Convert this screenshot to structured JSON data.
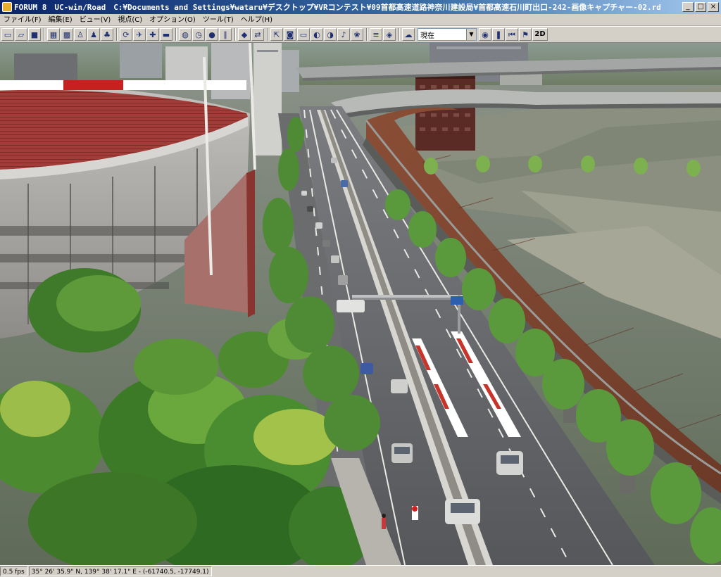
{
  "window": {
    "title": "FORUM 8　UC-win/Road　C:¥Documents and Settings¥wataru¥デスクトップ¥VRコンテスト¥09首都高速道路神奈川建設局¥首都高速石川町出口-242-画像キャプチャー-02.rd",
    "controls": {
      "minimize": "_",
      "maximize": "□",
      "close": "×"
    }
  },
  "menu": {
    "items": [
      "ファイル(F)",
      "編集(E)",
      "ビュー(V)",
      "視点(C)",
      "オプション(O)",
      "ツール(T)",
      "ヘルプ(H)"
    ]
  },
  "toolbar": {
    "icons": [
      "new-file-icon",
      "open-folder-icon",
      "save-icon",
      "sep",
      "scene-view-icon",
      "map-view-icon",
      "walk-icon",
      "pedestrian-icon",
      "tree-icon",
      "sep",
      "rotate-icon",
      "flight-icon",
      "driving-icon",
      "vehicle-icon",
      "sep",
      "globe-icon",
      "clock-icon",
      "stop-sign-icon",
      "pause-icon",
      "sep",
      "car-icon",
      "traffic-icon",
      "sep",
      "export-icon",
      "camera-icon",
      "screen-icon",
      "palette-icon",
      "color-wheel-icon",
      "sound-icon",
      "sep",
      "graphics-icon",
      "record-icon",
      "sep",
      "weather-icon"
    ],
    "time_value": "現在",
    "extra_icons": [
      "signal-icon",
      "pause-playback-icon",
      "rewind-icon",
      "flag-icon"
    ],
    "mode_label": "2D"
  },
  "status": {
    "fps": "0.5 fps",
    "coordinates": "35°  26' 35.9\" N, 139°  38' 17.1\"  E  -  (-61740.5, -17749.1)"
  },
  "colors": {
    "titlebar": "#0a246a",
    "window_bg": "#d4d0c8",
    "road": "#5a5c5e",
    "stadium_seats": "#a03a36"
  }
}
